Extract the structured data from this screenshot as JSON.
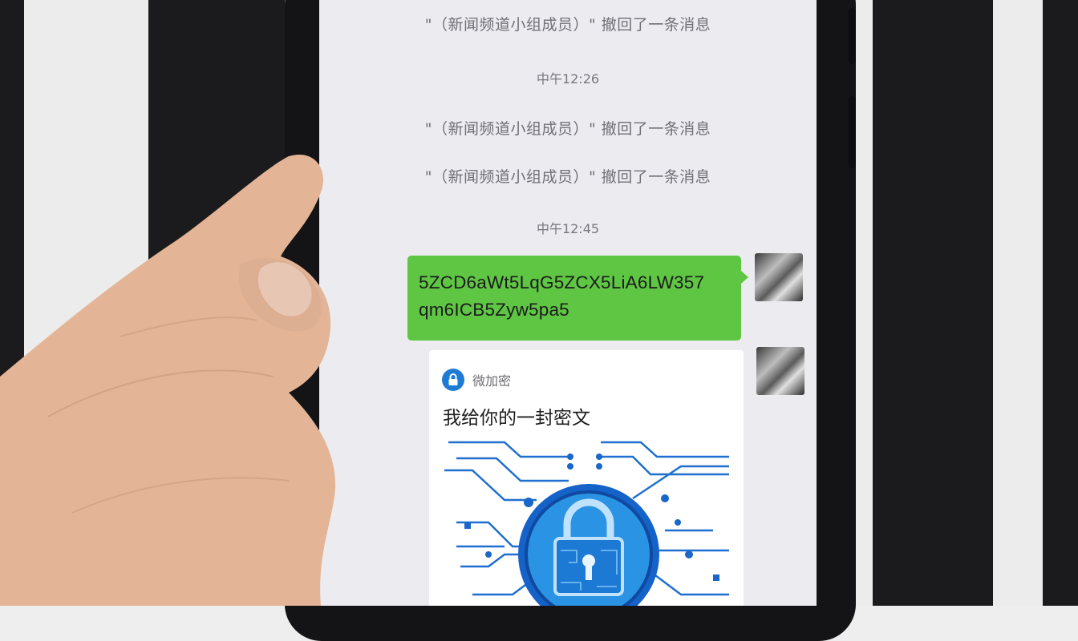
{
  "chat": {
    "messages": [
      {
        "kind": "system",
        "text": "\"（新闻频道小组成员）\" 撤回了一条消息"
      },
      {
        "kind": "time",
        "text": "中午12:26"
      },
      {
        "kind": "system",
        "text": "\"（新闻频道小组成员）\" 撤回了一条消息"
      },
      {
        "kind": "system",
        "text": "\"（新闻频道小组成员）\" 撤回了一条消息"
      },
      {
        "kind": "time",
        "text": "中午12:45"
      }
    ],
    "sent_text": {
      "line1": "5ZCD6aWt5LqG5ZCX5LiA6LW357",
      "line2": "qm6ICB5Zyw5pa5"
    },
    "card": {
      "app_name": "微加密",
      "title": "我给你的一封密文"
    }
  },
  "icons": [
    "lock-icon",
    "padlock-illustration",
    "user-avatar"
  ],
  "colors": {
    "bubble_green": "#5fc644",
    "card_accent": "#1d7bd6",
    "screen_bg": "#ececf0"
  }
}
